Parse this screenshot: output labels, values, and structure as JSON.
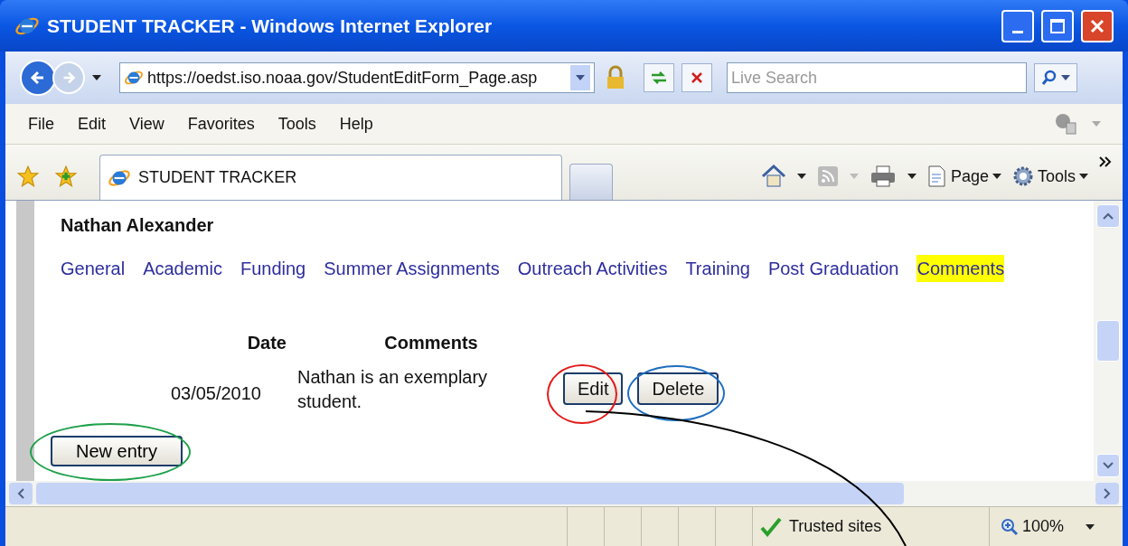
{
  "window": {
    "title": "STUDENT TRACKER - Windows Internet Explorer"
  },
  "address_bar": {
    "value": "https://oedst.iso.noaa.gov/StudentEditForm_Page.asp"
  },
  "search": {
    "placeholder": "Live Search"
  },
  "menu": [
    "File",
    "Edit",
    "View",
    "Favorites",
    "Tools",
    "Help"
  ],
  "tabs": [
    {
      "label": "STUDENT TRACKER",
      "selected": true
    }
  ],
  "command_bar": [
    "Page",
    "Tools"
  ],
  "page": {
    "student_name": "Nathan Alexander",
    "nav": [
      {
        "label": "General",
        "selected": false
      },
      {
        "label": "Academic",
        "selected": false
      },
      {
        "label": "Funding",
        "selected": false
      },
      {
        "label": "Summer Assignments",
        "selected": false
      },
      {
        "label": "Outreach Activities",
        "selected": false
      },
      {
        "label": "Training",
        "selected": false
      },
      {
        "label": "Post Graduation",
        "selected": false
      },
      {
        "label": "Comments",
        "selected": true
      }
    ],
    "table": {
      "columns": [
        "Date",
        "Comments"
      ],
      "rows": [
        {
          "date": "03/05/2010",
          "comment": "Nathan is an exemplary student.",
          "actions": [
            "Edit",
            "Delete"
          ]
        }
      ]
    },
    "new_entry_button": "New entry"
  },
  "annotations": [
    {
      "color": "#e31b1b"
    },
    {
      "color": "#1f6fbf"
    },
    {
      "color": "#1ea04a"
    }
  ],
  "status_bar": {
    "zone": "Trusted sites",
    "zoom": "100%"
  }
}
